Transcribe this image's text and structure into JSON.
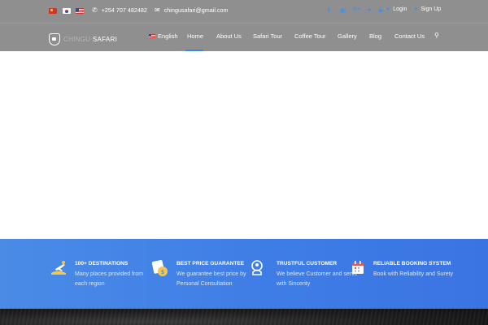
{
  "topbar": {
    "flags": [
      "flag-china",
      "flag-korea",
      "flag-usa"
    ],
    "phone": "+254 707 482482",
    "email": "chingusafari@gmail.com",
    "social_icons": [
      "facebook-icon",
      "instagram-icon",
      "google-plus-icon",
      "twitter-icon",
      "youtube-icon"
    ],
    "login_label": "Login",
    "signup_label": "Sign Up"
  },
  "logo": {
    "text_dim": "CHINGU",
    "text_bright": "SAFARI"
  },
  "nav": {
    "language": "English",
    "items": [
      "Home",
      "About Us",
      "Safari Tour",
      "Coffee Tour",
      "Gallery",
      "Blog",
      "Contact Us"
    ],
    "active": "Home"
  },
  "features": [
    {
      "title": "100+ DESTINATIONS",
      "desc": "Many places provided from each region",
      "icon": "plane-destination-icon"
    },
    {
      "title": "BEST PRICE GUARANTEE",
      "desc": "We guarantee best price by Personal Consultation",
      "icon": "price-tag-icon"
    },
    {
      "title": "TRUSTFUL CUSTOMER",
      "desc": "We believe Customer and serve with Sincerity",
      "icon": "handshake-icon"
    },
    {
      "title": "RELIABLE BOOKING SYSTEM",
      "desc": "Book with Reliability and Surety",
      "icon": "calendar-booking-icon"
    }
  ],
  "colors": {
    "header_bg": "#8f8f8f",
    "accent": "#3f86e0",
    "features_bg": "#4180e6"
  }
}
